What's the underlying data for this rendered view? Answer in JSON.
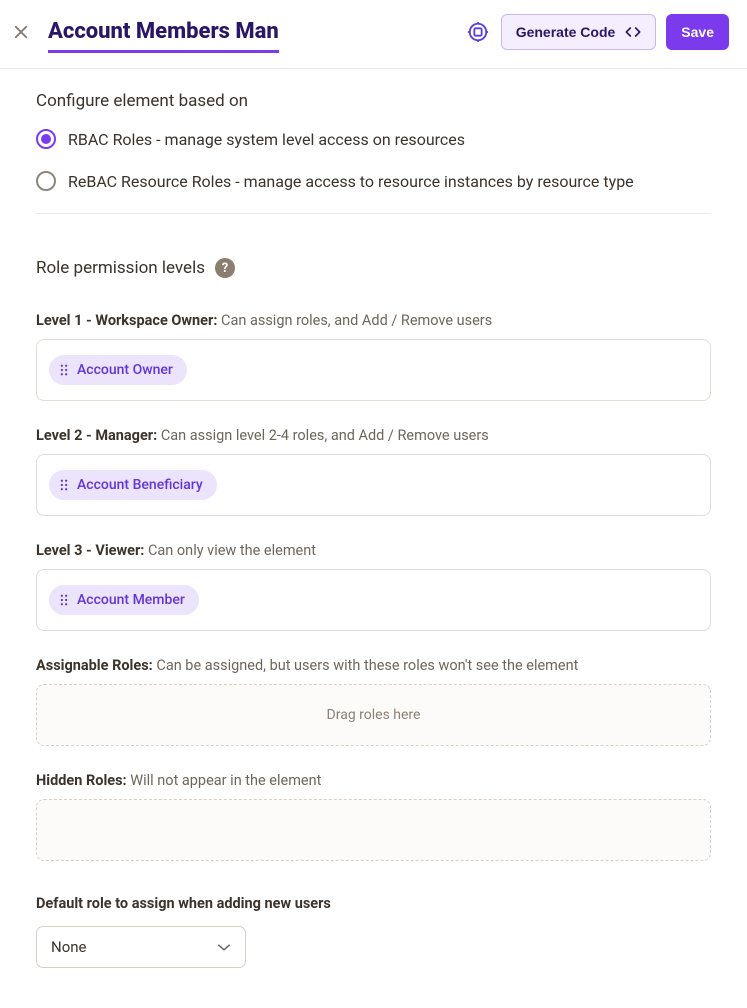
{
  "header": {
    "title": "Account Members Man",
    "generate_code_label": "Generate Code",
    "save_label": "Save"
  },
  "configure": {
    "heading": "Configure element based on",
    "options": [
      {
        "label": "RBAC Roles - manage system level access on resources",
        "selected": true
      },
      {
        "label": "ReBAC Resource Roles - manage access to resource instances by resource type",
        "selected": false
      }
    ]
  },
  "permissions": {
    "heading": "Role permission levels",
    "levels": [
      {
        "title": "Level 1 - Workspace Owner:",
        "desc": "Can assign roles, and Add / Remove users",
        "chips": [
          "Account Owner"
        ]
      },
      {
        "title": "Level 2 - Manager:",
        "desc": "Can assign level 2-4 roles, and Add / Remove users",
        "chips": [
          "Account Beneficiary"
        ]
      },
      {
        "title": "Level 3 - Viewer:",
        "desc": "Can only view the element",
        "chips": [
          "Account Member"
        ]
      }
    ],
    "assignable": {
      "title": "Assignable Roles:",
      "desc": "Can be assigned, but users with these roles won't see the element",
      "placeholder": "Drag roles here"
    },
    "hidden": {
      "title": "Hidden Roles:",
      "desc": "Will not appear in the element"
    }
  },
  "default_role": {
    "label": "Default role to assign when adding new users",
    "selected": "None"
  }
}
